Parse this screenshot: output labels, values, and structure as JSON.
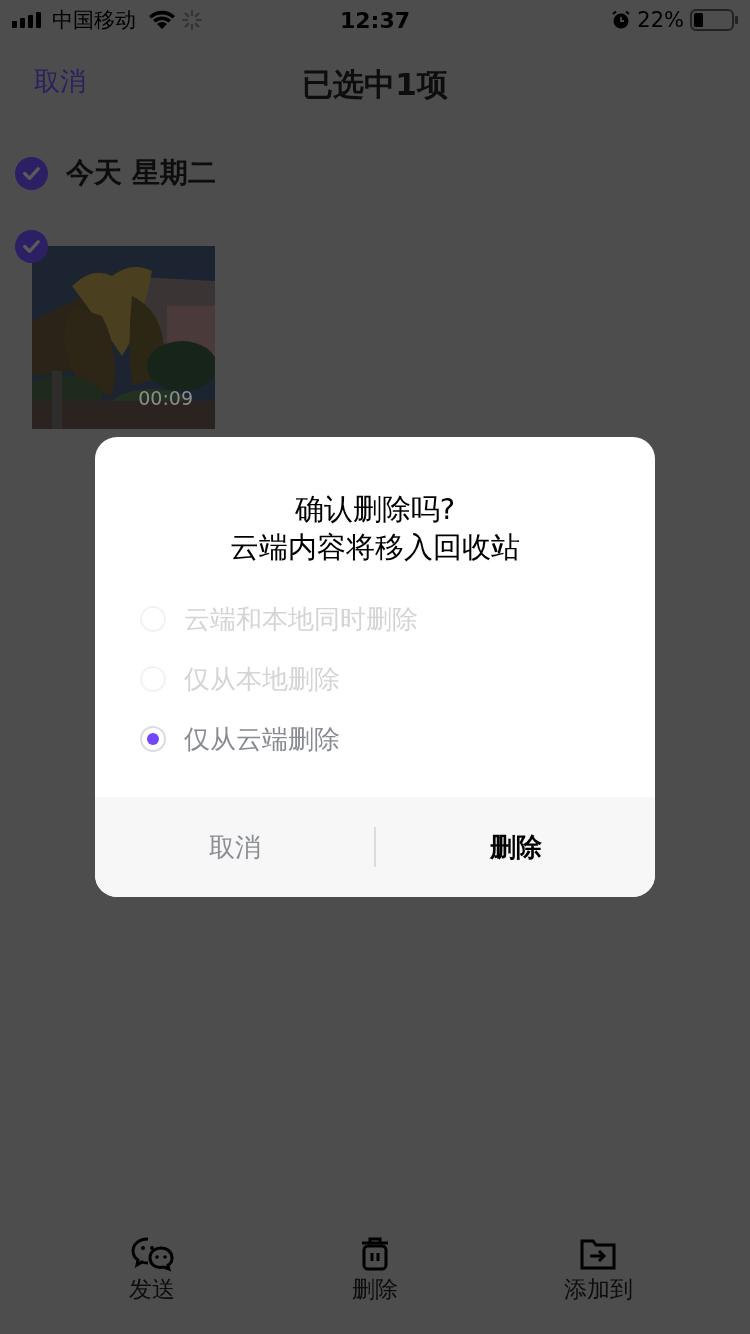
{
  "status_bar": {
    "carrier": "中国移动",
    "time": "12:37",
    "battery": "22%"
  },
  "header": {
    "cancel": "取消",
    "title": "已选中1项"
  },
  "group": {
    "date": "今天 星期二",
    "checked": true,
    "items": [
      {
        "kind": "picture",
        "duration": "00:09",
        "checked": true
      }
    ]
  },
  "dialog": {
    "title_lines": [
      "确认删除吗?",
      "云端内容将移入回收站"
    ],
    "options": [
      {
        "label": "云端和本地同时删除",
        "selected": false
      },
      {
        "label": "仅从本地删除",
        "selected": false
      },
      {
        "label": "仅从云端删除",
        "selected": true
      }
    ],
    "buttons": [
      {
        "label": "取消",
        "kind": "cancel"
      },
      {
        "label": "删除",
        "kind": "confirm"
      }
    ]
  },
  "toolbar": [
    {
      "label": "发送",
      "kind": "chat"
    },
    {
      "label": "删除",
      "kind": "trash"
    },
    {
      "label": "添加到",
      "kind": "folder"
    }
  ]
}
